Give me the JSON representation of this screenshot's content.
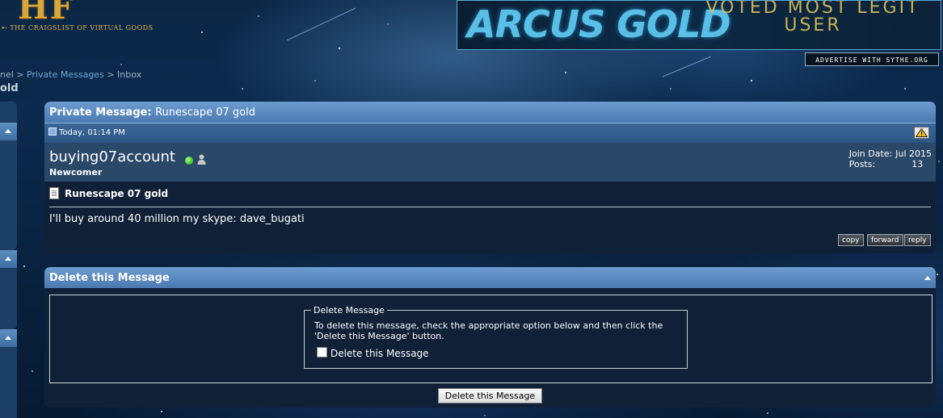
{
  "header": {
    "logo_text": "HF",
    "logo_tagline": "THE CRAIGSLIST OF VIRTUAL GOODS",
    "banner_left": "ARCUS GOLD",
    "banner_right": "VOTED MOST LEGIT USER",
    "advertise_label": "ADVERTISE WITH SYTHE.ORG"
  },
  "breadcrumb": {
    "first": "nel",
    "sep": ">",
    "second": "Private Messages",
    "third": "Inbox",
    "current": "old"
  },
  "message_panel": {
    "title_label": "Private Message",
    "title_value": "Runescape 07 gold",
    "date": "Today, 01:14 PM",
    "username": "buying07account",
    "usertitle": "Newcomer",
    "join_date_label": "Join Date:",
    "join_date_value": "Jul 2015",
    "posts_label": "Posts:",
    "posts_value": "13",
    "subject": "Runescape 07 gold",
    "body": "I'll buy around 40 million my skype: dave_bugati",
    "buttons": {
      "copy": "copy",
      "forward": "forward",
      "reply": "reply"
    }
  },
  "delete_panel": {
    "title": "Delete this Message",
    "fieldset_legend": "Delete Message",
    "instructions": "To delete this message, check the appropriate option below and then click the 'Delete this Message' button.",
    "checkbox_label": "Delete this Message",
    "checkbox_checked": false,
    "submit_label": "Delete this Message"
  },
  "colors": {
    "panel_head": "#5a8ac0",
    "panel_body": "#0f2037",
    "user_bar": "#2a4868",
    "online": "#1aa11a"
  }
}
